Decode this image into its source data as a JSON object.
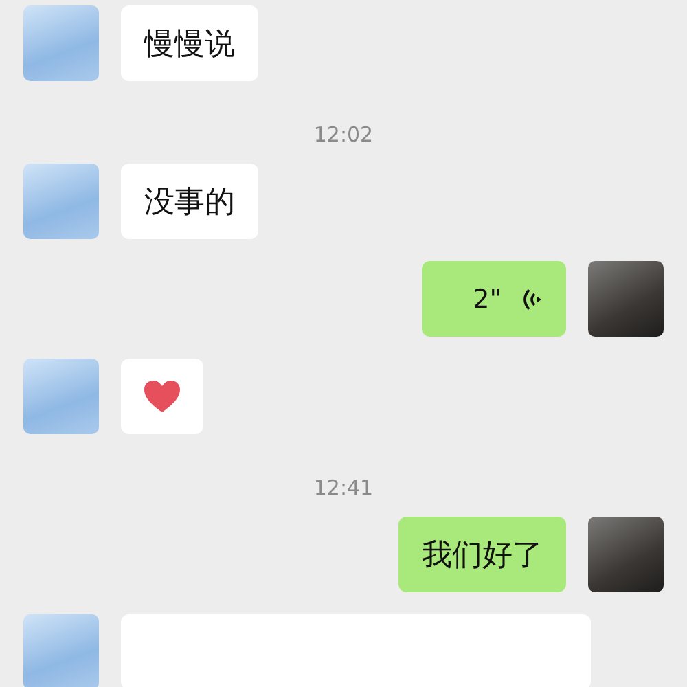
{
  "messages": [
    {
      "kind": "text",
      "outgoing": false,
      "text": "慢慢说"
    },
    {
      "kind": "time",
      "text": "12:02"
    },
    {
      "kind": "text",
      "outgoing": false,
      "text": "没事的"
    },
    {
      "kind": "voice",
      "outgoing": true,
      "text": "2\""
    },
    {
      "kind": "heart",
      "outgoing": false
    },
    {
      "kind": "time",
      "text": "12:41"
    },
    {
      "kind": "text",
      "outgoing": true,
      "text": "我们好了"
    },
    {
      "kind": "blank",
      "outgoing": false
    }
  ]
}
